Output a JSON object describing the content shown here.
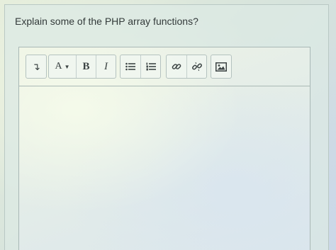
{
  "question": {
    "text": "Explain some of the PHP array functions?"
  },
  "toolbar": {
    "format_glyph": "↴",
    "font_label": "A",
    "font_caret": "▼",
    "bold_label": "B",
    "italic_label": "I"
  },
  "icons": {
    "paragraph_format": "paragraph-format-icon",
    "font_menu": "font-menu-icon",
    "bold": "bold-icon",
    "italic": "italic-icon",
    "bulleted_list": "bulleted-list-icon",
    "numbered_list": "numbered-list-icon",
    "link": "link-icon",
    "unlink": "unlink-icon",
    "image": "image-icon"
  },
  "colors": {
    "panel": "#dceae4",
    "text": "#333a3a",
    "border": "#a9b8b6"
  }
}
